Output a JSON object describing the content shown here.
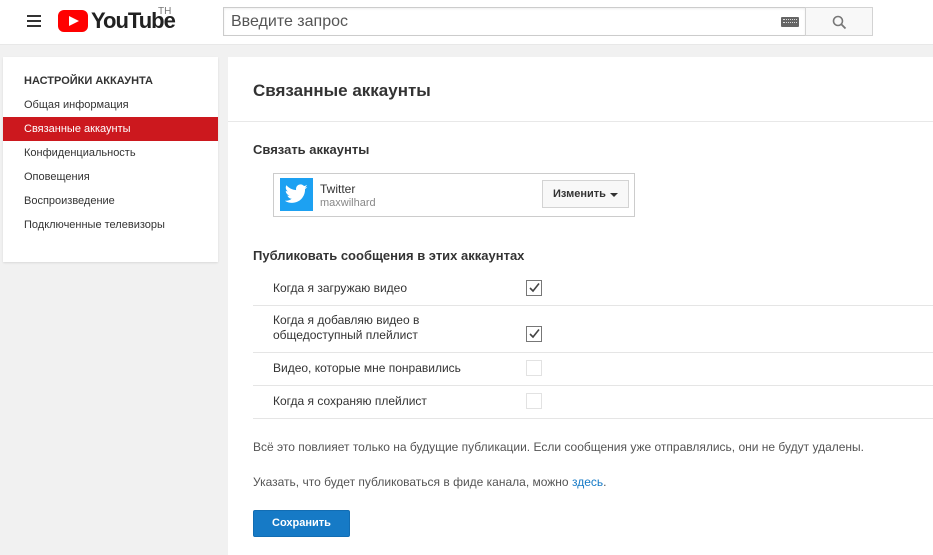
{
  "header": {
    "logo_text": "YouTube",
    "region": "TH",
    "search_placeholder": "Введите запрос"
  },
  "sidebar": {
    "title": "НАСТРОЙКИ АККАУНТА",
    "items": [
      {
        "label": "Общая информация",
        "active": false
      },
      {
        "label": "Связанные аккаунты",
        "active": true
      },
      {
        "label": "Конфиденциальность",
        "active": false
      },
      {
        "label": "Оповещения",
        "active": false
      },
      {
        "label": "Воспроизведение",
        "active": false
      },
      {
        "label": "Подключенные телевизоры",
        "active": false
      }
    ]
  },
  "main": {
    "page_title": "Связанные аккаунты",
    "link_section_title": "Связать аккаунты",
    "account": {
      "service": "Twitter",
      "username": "maxwilhard",
      "change_label": "Изменить"
    },
    "publish_section_title": "Публиковать сообщения в этих аккаунтах",
    "options": [
      {
        "label": "Когда я загружаю видео",
        "checked": true
      },
      {
        "label": "Когда я добавляю видео в общедоступный плейлист",
        "checked": true
      },
      {
        "label": "Видео, которые мне понравились",
        "checked": false
      },
      {
        "label": "Когда я сохраняю плейлист",
        "checked": false
      }
    ],
    "note_future": "Всё это повлияет только на будущие публикации. Если сообщения уже отправлялись, они не будут удалены.",
    "note_feed_prefix": "Указать, что будет публиковаться в фиде канала, можно ",
    "note_feed_link": "здесь",
    "note_feed_suffix": ".",
    "save_label": "Сохранить"
  },
  "colors": {
    "accent_red": "#cc181e",
    "button_blue": "#167ac6",
    "twitter_blue": "#1da1f2"
  }
}
